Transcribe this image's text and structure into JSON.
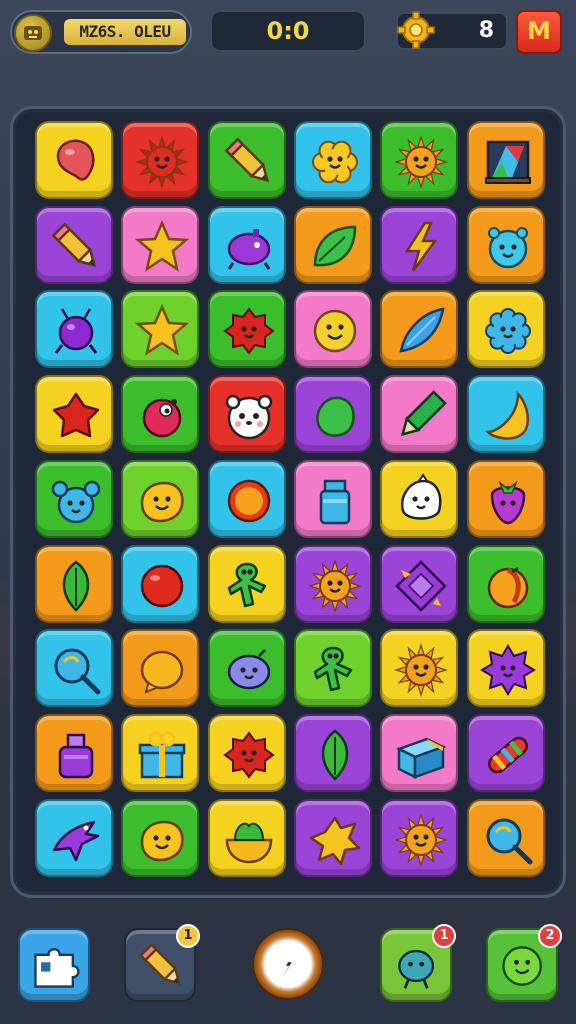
{
  "hud": {
    "level_name": "MZ6S. OLEU",
    "score": "0:0",
    "coins": "8",
    "menu_label": "M"
  },
  "colors": {
    "yellow": "#f5d21f",
    "red": "#e5312a",
    "green": "#3cbd2c",
    "cyan": "#32c3ea",
    "purple": "#9b45d8",
    "orange": "#f39a1a",
    "pink": "#f27ac8",
    "lime": "#6ed12c"
  },
  "grid": [
    [
      {
        "bg": "yellow",
        "icon": "balloon"
      },
      {
        "bg": "red",
        "icon": "sun-creature"
      },
      {
        "bg": "green",
        "icon": "pencil"
      },
      {
        "bg": "cyan",
        "icon": "flower-face"
      },
      {
        "bg": "green",
        "icon": "sun"
      },
      {
        "bg": "orange",
        "icon": "crystal-frame"
      }
    ],
    [
      {
        "bg": "purple",
        "icon": "pencil"
      },
      {
        "bg": "pink",
        "icon": "star"
      },
      {
        "bg": "cyan",
        "icon": "purple-blob"
      },
      {
        "bg": "orange",
        "icon": "leaf"
      },
      {
        "bg": "purple",
        "icon": "lightning-pencil"
      },
      {
        "bg": "orange",
        "icon": "blue-face"
      }
    ],
    [
      {
        "bg": "cyan",
        "icon": "purple-bug"
      },
      {
        "bg": "lime",
        "icon": "star"
      },
      {
        "bg": "green",
        "icon": "red-blob"
      },
      {
        "bg": "pink",
        "icon": "smiley"
      },
      {
        "bg": "orange",
        "icon": "fish"
      },
      {
        "bg": "yellow",
        "icon": "blue-flower"
      }
    ],
    [
      {
        "bg": "yellow",
        "icon": "red-splash"
      },
      {
        "bg": "green",
        "icon": "red-creature"
      },
      {
        "bg": "red",
        "icon": "panda"
      },
      {
        "bg": "purple",
        "icon": "green-blob"
      },
      {
        "bg": "pink",
        "icon": "green-pencil"
      },
      {
        "bg": "cyan",
        "icon": "yellow-banana"
      }
    ],
    [
      {
        "bg": "green",
        "icon": "blue-mouse"
      },
      {
        "bg": "lime",
        "icon": "yellow-face"
      },
      {
        "bg": "cyan",
        "icon": "orange-ball"
      },
      {
        "bg": "pink",
        "icon": "jar"
      },
      {
        "bg": "yellow",
        "icon": "white-ghost"
      },
      {
        "bg": "orange",
        "icon": "berry"
      }
    ],
    [
      {
        "bg": "orange",
        "icon": "green-leaf"
      },
      {
        "bg": "cyan",
        "icon": "red-ball"
      },
      {
        "bg": "yellow",
        "icon": "green-worm"
      },
      {
        "bg": "purple",
        "icon": "sun"
      },
      {
        "bg": "purple",
        "icon": "diamond-gem"
      },
      {
        "bg": "green",
        "icon": "orange-fruit"
      }
    ],
    [
      {
        "bg": "cyan",
        "icon": "magnifier"
      },
      {
        "bg": "orange",
        "icon": "egg"
      },
      {
        "bg": "green",
        "icon": "blue-blob"
      },
      {
        "bg": "lime",
        "icon": "green-worm"
      },
      {
        "bg": "yellow",
        "icon": "sun"
      },
      {
        "bg": "yellow",
        "icon": "purple-spiky"
      }
    ],
    [
      {
        "bg": "orange",
        "icon": "potion"
      },
      {
        "bg": "yellow",
        "icon": "gift-box"
      },
      {
        "bg": "yellow",
        "icon": "red-blob"
      },
      {
        "bg": "purple",
        "icon": "green-leaf"
      },
      {
        "bg": "pink",
        "icon": "blue-cube"
      },
      {
        "bg": "purple",
        "icon": "striped-candy"
      }
    ],
    [
      {
        "bg": "cyan",
        "icon": "purple-bird"
      },
      {
        "bg": "green",
        "icon": "yellow-face"
      },
      {
        "bg": "yellow",
        "icon": "salad-bowl"
      },
      {
        "bg": "purple",
        "icon": "yellow-splat"
      },
      {
        "bg": "purple",
        "icon": "sun"
      },
      {
        "bg": "orange",
        "icon": "magnifier"
      }
    ]
  ],
  "bottom": {
    "buttons": [
      {
        "name": "puzzle-button",
        "icon": "puzzle",
        "bg": "#3aa6e8",
        "badge": ""
      },
      {
        "name": "pencil-booster-button",
        "icon": "pencil",
        "bg": "#3f5068",
        "badge": "1",
        "badge_color": "#f2c744"
      },
      {
        "name": "compass-button",
        "icon": "compass",
        "bg": "",
        "badge": ""
      },
      {
        "name": "blue-creature-booster-button",
        "icon": "blue-creature",
        "bg": "#7ac63a",
        "badge": "1",
        "badge_color": "#e04040"
      },
      {
        "name": "smiley-booster-button",
        "icon": "smiley",
        "bg": "#55c23a",
        "badge": "2",
        "badge_color": "#e04040"
      }
    ]
  }
}
